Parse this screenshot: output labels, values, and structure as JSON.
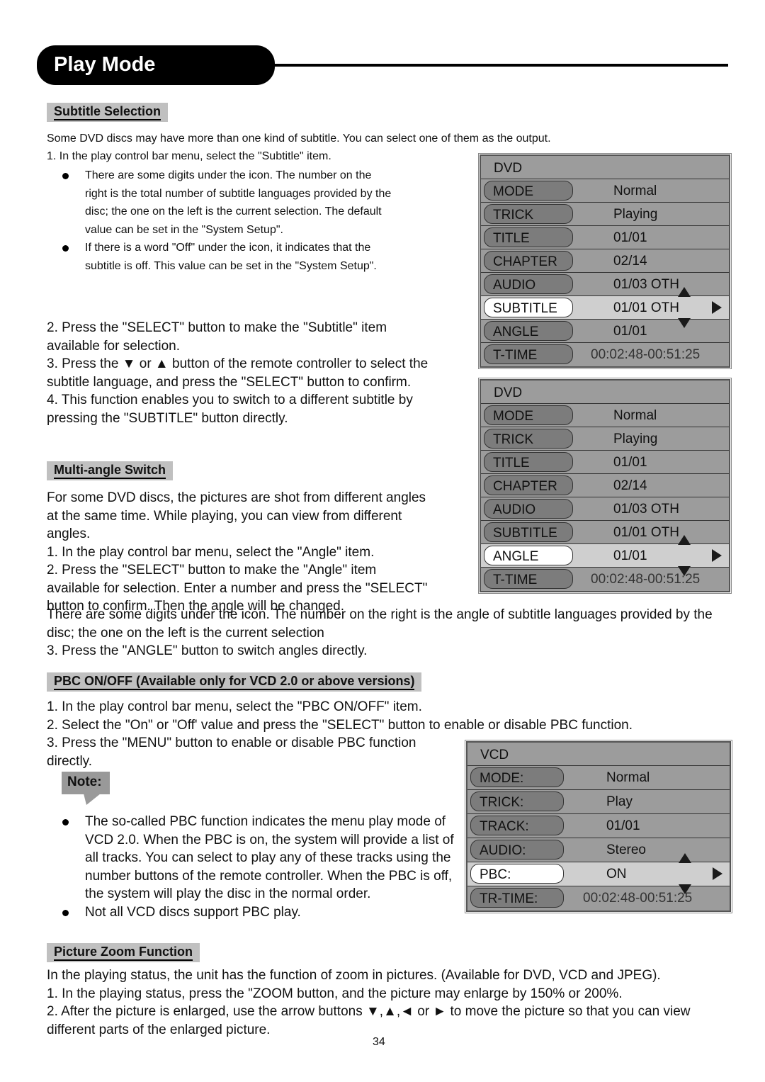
{
  "header": {
    "title": "Play Mode"
  },
  "subtitle_section": {
    "heading": "Subtitle Selection",
    "intro": "Some DVD discs may have more than one kind of subtitle. You can select one of them as the output.",
    "step1": "1. In the play control bar menu, select the \"Subtitle\" item.",
    "bullets": [
      "There are some digits under the icon. The number on the right is the total number of subtitle languages provided by the disc; the one on the left is the current selection. The default value can be set in the \"System Setup\".",
      "If there is a word \"Off\" under the icon, it indicates that the subtitle is off. This value can be set in the \"System Setup\"."
    ],
    "steps": "2. Press the \"SELECT\" button to make the \"Subtitle\" item available for selection.\n3. Press the ▼ or ▲ button of the remote controller to select the subtitle language, and press the \"SELECT\" button to confirm.\n4. This function enables you to switch to a different subtitle by pressing the \"SUBTITLE\" button directly."
  },
  "angle_section": {
    "heading": "Multi-angle Switch",
    "text": "For some DVD discs, the pictures are shot from different angles at the same time. While playing, you can view from different angles.\n1. In the play control bar menu, select the \"Angle\" item.\n2. Press the \"SELECT\" button to make the \"Angle\" item available for selection. Enter a number and press the \"SELECT\" button to confirm. Then the angle will be changed.",
    "text_wide": "There are some digits under the icon. The number on the right is the angle of subtitle languages provided by the disc; the one on the left is the current selection\n3. Press the \"ANGLE\" button to switch angles directly."
  },
  "pbc_section": {
    "heading": "PBC ON/OFF (Available only for VCD 2.0 or above versions)",
    "text_wide": "1. In the play control bar menu, select the \"PBC ON/OFF\" item.\n2. Select the \"On\" or \"Off' value and press the \"SELECT\" button to enable or disable PBC function.",
    "step3": "3. Press the \"MENU\" button to enable or disable PBC function directly.",
    "note_label": "Note:",
    "bullets": [
      "The so-called PBC function indicates the menu play mode of VCD 2.0. When the PBC is on, the system will provide a list of all tracks. You can select to play any of these tracks using the number buttons of the remote controller. When the PBC is off, the system will play the disc in the normal order.",
      "Not all VCD discs support PBC play."
    ]
  },
  "zoom_section": {
    "heading": "Picture Zoom Function",
    "text": "In the playing status, the unit has the function of zoom in pictures. (Available for DVD, VCD and JPEG).\n1. In the playing status, press the \"ZOOM button, and the picture may enlarge by 150% or 200%.\n2. After the picture is enlarged, use the arrow buttons ▼,▲,◄ or ► to move the picture so that you can view different parts of the enlarged picture."
  },
  "osd1": {
    "title": "DVD",
    "rows": [
      {
        "label": "MODE",
        "value": "Normal"
      },
      {
        "label": "TRICK",
        "value": "Playing"
      },
      {
        "label": "TITLE",
        "value": "01/01"
      },
      {
        "label": "CHAPTER",
        "value": "02/14"
      },
      {
        "label": "AUDIO",
        "value": "01/03 OTH"
      },
      {
        "label": "SUBTITLE",
        "value": "01/01 OTH"
      },
      {
        "label": "ANGLE",
        "value": "01/01"
      },
      {
        "label": "T-TIME",
        "value": "00:02:48-00:51:25"
      }
    ],
    "selected": "SUBTITLE"
  },
  "osd2": {
    "title": "DVD",
    "rows": [
      {
        "label": "MODE",
        "value": "Normal"
      },
      {
        "label": "TRICK",
        "value": "Playing"
      },
      {
        "label": "TITLE",
        "value": "01/01"
      },
      {
        "label": "CHAPTER",
        "value": "02/14"
      },
      {
        "label": "AUDIO",
        "value": "01/03 OTH"
      },
      {
        "label": "SUBTITLE",
        "value": "01/01 OTH"
      },
      {
        "label": "ANGLE",
        "value": "01/01"
      },
      {
        "label": "T-TIME",
        "value": "00:02:48-00:51:25"
      }
    ],
    "selected": "ANGLE"
  },
  "osd3": {
    "title": "VCD",
    "rows": [
      {
        "label": "MODE:",
        "value": "Normal"
      },
      {
        "label": "TRICK:",
        "value": "Play"
      },
      {
        "label": "TRACK:",
        "value": "01/01"
      },
      {
        "label": "AUDIO:",
        "value": "Stereo"
      },
      {
        "label": "PBC:",
        "value": "ON"
      },
      {
        "label": "TR-TIME:",
        "value": "00:02:48-00:51:25"
      }
    ],
    "selected": "PBC:"
  },
  "footer": {
    "page_number": "34"
  }
}
